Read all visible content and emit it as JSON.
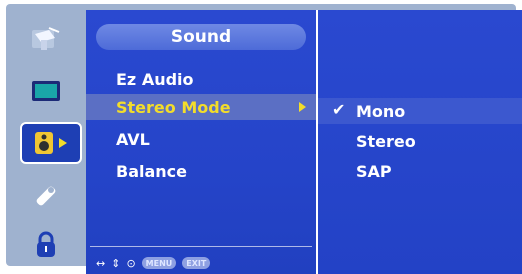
{
  "sidebar": {
    "icons": [
      {
        "name": "picture-icon"
      },
      {
        "name": "screen-icon"
      },
      {
        "name": "sound-icon",
        "active": true
      },
      {
        "name": "option-icon"
      },
      {
        "name": "lock-icon"
      }
    ]
  },
  "menu": {
    "title": "Sound",
    "items": [
      {
        "label": "Ez Audio"
      },
      {
        "label": "Stereo Mode",
        "selected": true
      },
      {
        "label": "AVL"
      },
      {
        "label": "Balance"
      }
    ],
    "footer": {
      "move_glyph": "↔",
      "updown_glyph": "⇕",
      "ok_glyph": "⊙",
      "menu_label": "MENU",
      "exit_label": "EXIT"
    }
  },
  "submenu": {
    "check_glyph": "✔",
    "items": [
      {
        "label": "Mono",
        "checked": true
      },
      {
        "label": "Stereo"
      },
      {
        "label": "SAP"
      }
    ]
  },
  "colors": {
    "panel_blue": "#2a49d0",
    "highlight_text": "#f3dd2a",
    "frame_gray": "#9fb2cf"
  }
}
